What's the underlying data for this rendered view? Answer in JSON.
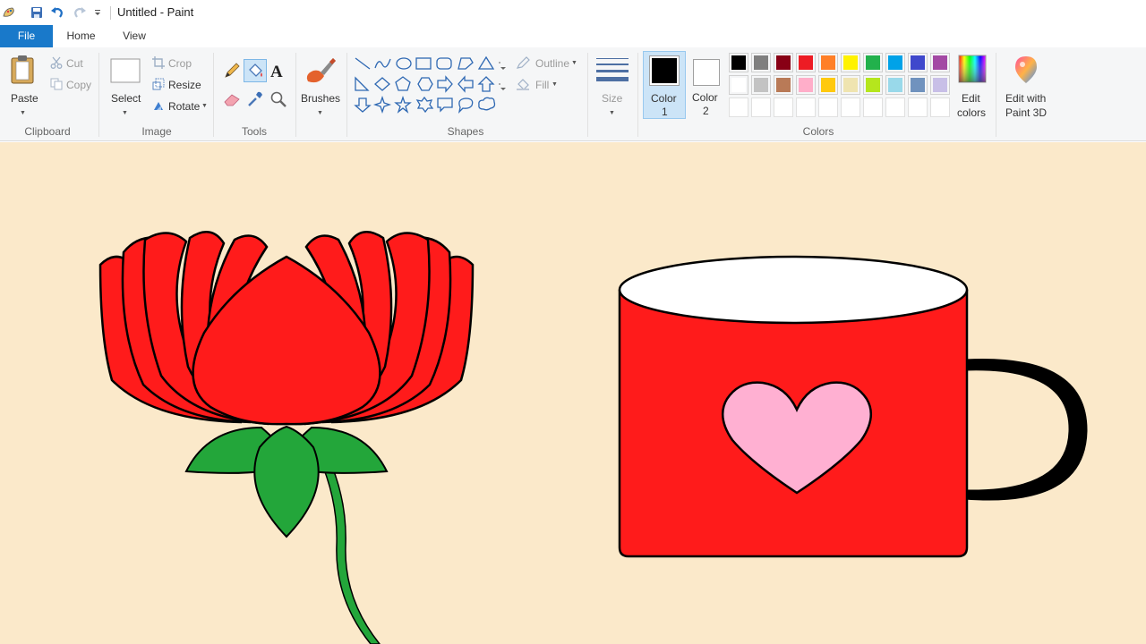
{
  "window": {
    "title": "Untitled - Paint"
  },
  "quick_access": {
    "icons": [
      "paint-app-icon",
      "save-icon",
      "undo-icon",
      "redo-icon",
      "customize-dropdown-icon"
    ]
  },
  "tabs": [
    {
      "label": "File",
      "active": true
    },
    {
      "label": "Home",
      "active": false
    },
    {
      "label": "View",
      "active": false
    }
  ],
  "ribbon": {
    "clipboard": {
      "group_label": "Clipboard",
      "paste_label": "Paste",
      "cut_label": "Cut",
      "copy_label": "Copy"
    },
    "image": {
      "group_label": "Image",
      "select_label": "Select",
      "crop_label": "Crop",
      "resize_label": "Resize",
      "rotate_label": "Rotate"
    },
    "tools": {
      "group_label": "Tools",
      "selected_tool": "fill-with-color"
    },
    "brushes": {
      "label": "Brushes"
    },
    "shapes": {
      "group_label": "Shapes",
      "outline_label": "Outline",
      "fill_label": "Fill"
    },
    "size": {
      "label": "Size"
    },
    "colors": {
      "group_label": "Colors",
      "color1_label": "Color",
      "color1_num": "1",
      "color2_label": "Color",
      "color2_num": "2",
      "color1_value": "#000000",
      "color2_value": "#ffffff",
      "edit_colors_line1": "Edit",
      "edit_colors_line2": "colors",
      "paint3d_line1": "Edit with",
      "paint3d_line2": "Paint 3D",
      "palette_row1": [
        "#000000",
        "#7f7f7f",
        "#880015",
        "#ed1c24",
        "#ff7f27",
        "#fff200",
        "#22b14c",
        "#00a2e8",
        "#3f48cc",
        "#a349a4"
      ],
      "palette_row2": [
        "#ffffff",
        "#c3c3c3",
        "#b97a57",
        "#ffaec9",
        "#ffc90e",
        "#efe4b0",
        "#b5e61d",
        "#99d9ea",
        "#7092be",
        "#c8bfe7"
      ],
      "palette_row3": [
        "#ffffff",
        "#ffffff",
        "#ffffff",
        "#ffffff",
        "#ffffff",
        "#ffffff",
        "#ffffff",
        "#ffffff",
        "#ffffff",
        "#ffffff"
      ]
    }
  },
  "canvas": {
    "background": "#fbe9ca",
    "drawings": {
      "lotus": {
        "petal_color": "#ff1b1b",
        "leaf_color": "#23a63a",
        "stem_color": "#23a63a"
      },
      "mug": {
        "body_color": "#ff1b1b",
        "rim_color": "#ffffff",
        "heart_color": "#ffb0d2",
        "handle_color": "#000000"
      }
    }
  }
}
